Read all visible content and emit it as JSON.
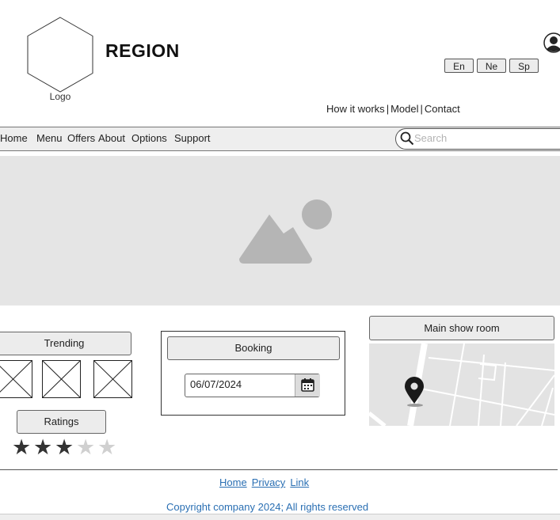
{
  "header": {
    "logo_label": "Logo",
    "brand": "REGION",
    "languages": [
      "En",
      "Ne",
      "Sp"
    ],
    "top_links": [
      "How it works",
      "Model",
      "Contact"
    ],
    "user_icon": "user-icon"
  },
  "nav": {
    "items": [
      "Home",
      "Menu",
      "Offers",
      "About",
      "Options",
      "Support"
    ],
    "search_placeholder": "Search",
    "search_icon": "search-icon"
  },
  "hero": {
    "icon": "image-placeholder-icon"
  },
  "widgets": {
    "trending_label": "Trending",
    "ratings_label": "Ratings",
    "rating": {
      "value": 3,
      "max": 5
    },
    "booking_label": "Booking",
    "booking_date": "06/07/2024",
    "calendar_icon": "calendar-icon",
    "showroom_label": "Main show room",
    "map_icon": "map-pin-icon"
  },
  "footer": {
    "links": [
      "Home",
      "Privacy",
      "Link"
    ],
    "copyright": "Copyright company 2024; All rights reserved"
  },
  "colors": {
    "link": "#2a6fb3",
    "panel": "#ececec",
    "hero_bg": "#e5e5e5",
    "star_on": "#333333",
    "star_off": "#d0d0d0"
  }
}
